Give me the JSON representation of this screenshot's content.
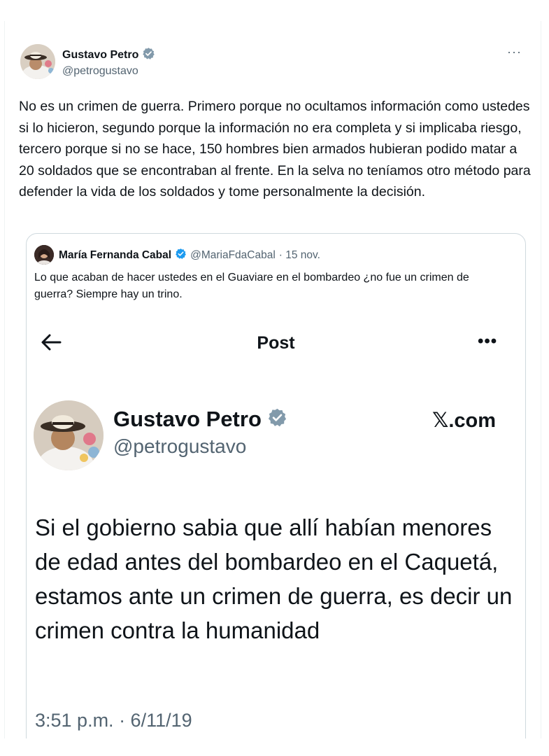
{
  "outer_tweet": {
    "author_name": "Gustavo Petro",
    "author_handle": "@petrogustavo",
    "more_label": "···",
    "text": "No es un crimen de guerra. Primero porque no ocultamos información como ustedes si lo hicieron, segundo porque la información no era completa y si implicaba riesgo, tercero porque si no se hace, 150 hombres bien armados hubieran podido  matar a 20 soldados que se encontraban al frente. En la selva no teníamos otro método para defender la vida de los soldados y tome personalmente la decisión.",
    "verified_icon": "verified-badge-icon"
  },
  "quoted_tweet": {
    "author_name": "María Fernanda Cabal",
    "author_handle": "@MariaFdaCabal",
    "date": "· 15 nov.",
    "text": "Lo que acaban de hacer ustedes en el Guaviare en el bombardeo ¿no fue un crimen de guerra? Siempre hay un trino.",
    "verified_icon": "verified-badge-icon"
  },
  "embedded_screenshot": {
    "back_icon": "back-arrow-icon",
    "title": "Post",
    "more_label": "•••",
    "author_name": "Gustavo Petro",
    "author_handle": "@petrogustavo",
    "watermark": "𝕏.com",
    "text": "Si el gobierno sabia que allí habían menores de edad antes del bombardeo en el Caquetá, estamos ante un crimen de guerra, es decir un crimen contra la humanidad",
    "timestamp": "3:51 p.m. · 6/11/19"
  },
  "colors": {
    "text_primary": "#0f1419",
    "text_secondary": "#536471",
    "verified_gray": "#829aab",
    "verified_blue": "#1d9bf0",
    "border": "#cfd9de"
  }
}
